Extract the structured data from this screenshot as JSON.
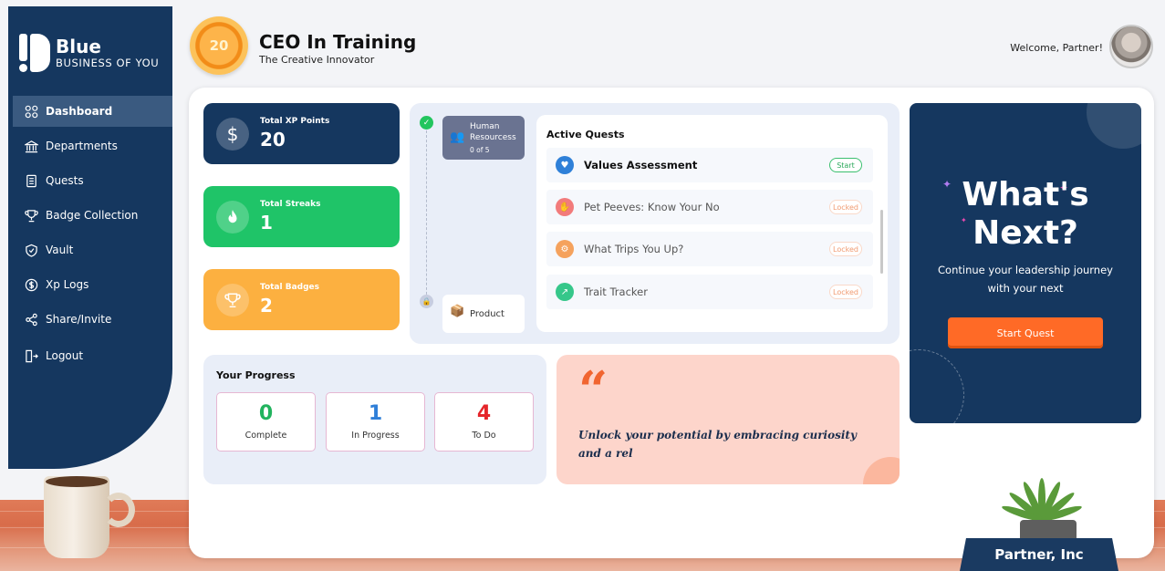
{
  "brand": {
    "name": "Blue",
    "tagline": "BUSINESS OF YOU"
  },
  "sidebar": {
    "items": [
      {
        "label": "Dashboard",
        "icon": "grid-icon",
        "active": true
      },
      {
        "label": "Departments",
        "icon": "building-icon"
      },
      {
        "label": "Quests",
        "icon": "scroll-icon"
      },
      {
        "label": "Badge Collection",
        "icon": "trophy-icon"
      },
      {
        "label": "Vault",
        "icon": "shield-icon"
      },
      {
        "label": "Xp Logs",
        "icon": "dollar-circle-icon"
      },
      {
        "label": "Share/Invite",
        "icon": "share-icon"
      },
      {
        "label": "Logout",
        "icon": "logout-icon"
      }
    ]
  },
  "header": {
    "level": "20",
    "title": "CEO In Training",
    "subtitle": "The Creative Innovator",
    "welcome": "Welcome, Partner!"
  },
  "stats": {
    "xp": {
      "label": "Total XP Points",
      "value": "20",
      "icon": "dollar-icon",
      "color": "#15375f"
    },
    "streaks": {
      "label": "Total Streaks",
      "value": "1",
      "icon": "flame-icon",
      "color": "#1fc468"
    },
    "badges": {
      "label": "Total Badges",
      "value": "2",
      "icon": "trophy-icon",
      "color": "#fcb040"
    }
  },
  "departments": [
    {
      "name": "Human Resourcess",
      "count": "0 of 5",
      "status": "completed"
    },
    {
      "name": "Product",
      "status": "locked"
    }
  ],
  "active_quests": {
    "title": "Active Quests",
    "items": [
      {
        "name": "Values Assessment",
        "action": "Start",
        "icon_color": "#2f80d8"
      },
      {
        "name": "Pet Peeves: Know Your No",
        "action": "Locked",
        "icon_color": "#f27b7b"
      },
      {
        "name": "What Trips You Up?",
        "action": "Locked",
        "icon_color": "#f5a25d"
      },
      {
        "name": "Trait Tracker",
        "action": "Locked",
        "icon_color": "#36c78a"
      }
    ]
  },
  "whats_next": {
    "title": "What's Next?",
    "description": "Continue your leadership journey with your next",
    "button": "Start Quest"
  },
  "progress": {
    "title": "Your Progress",
    "items": [
      {
        "value": "0",
        "label": "Complete",
        "color": "#22b35e"
      },
      {
        "value": "1",
        "label": "In Progress",
        "color": "#2f7fd8"
      },
      {
        "value": "4",
        "label": "To Do",
        "color": "#e5252a"
      }
    ]
  },
  "quote": {
    "mark": "“",
    "text": "Unlock your potential by embracing curiosity and a rel"
  },
  "nameplate": "Partner, Inc",
  "colors": {
    "navy": "#15375f",
    "orange": "#ff6a26",
    "green": "#1fc468",
    "amber": "#fcb040"
  }
}
